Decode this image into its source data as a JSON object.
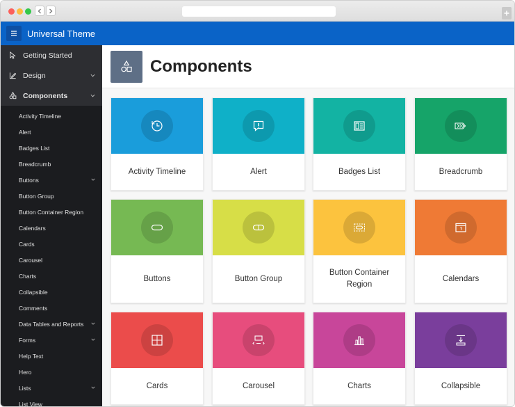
{
  "app": {
    "title": "Universal Theme"
  },
  "icons": {
    "menu": "hamburger-icon",
    "back": "chevron-left-icon",
    "forward": "chevron-right-icon",
    "newtab": "plus-icon"
  },
  "sidebar": {
    "top_items": [
      {
        "label": "Getting Started",
        "icon": "pointer-icon"
      },
      {
        "label": "Design",
        "icon": "design-icon"
      },
      {
        "label": "Components",
        "icon": "shapes-icon"
      }
    ],
    "sub_items": [
      {
        "label": "Activity Timeline"
      },
      {
        "label": "Alert"
      },
      {
        "label": "Badges List"
      },
      {
        "label": "Breadcrumb"
      },
      {
        "label": "Buttons"
      },
      {
        "label": "Button Group"
      },
      {
        "label": "Button Container Region"
      },
      {
        "label": "Calendars"
      },
      {
        "label": "Cards"
      },
      {
        "label": "Carousel"
      },
      {
        "label": "Charts"
      },
      {
        "label": "Collapsible"
      },
      {
        "label": "Comments"
      },
      {
        "label": "Data Tables and Reports"
      },
      {
        "label": "Forms"
      },
      {
        "label": "Help Text"
      },
      {
        "label": "Hero"
      },
      {
        "label": "Lists"
      },
      {
        "label": "List View"
      }
    ]
  },
  "page": {
    "title": "Components",
    "icon": "shapes-icon"
  },
  "cards": [
    {
      "label": "Activity Timeline",
      "color": "#1a9ddb",
      "icon": "clock-icon"
    },
    {
      "label": "Alert",
      "color": "#0fb0c8",
      "icon": "alert-icon"
    },
    {
      "label": "Badges List",
      "color": "#13b3a3",
      "icon": "badges-icon"
    },
    {
      "label": "Breadcrumb",
      "color": "#16a469",
      "icon": "breadcrumb-icon"
    },
    {
      "label": "Buttons",
      "color": "#76b953",
      "icon": "button-icon"
    },
    {
      "label": "Button Group",
      "color": "#d7de47",
      "icon": "button-group-icon"
    },
    {
      "label": "Button Container Region",
      "color": "#fcc33e",
      "icon": "button-container-icon"
    },
    {
      "label": "Calendars",
      "color": "#ef7a35",
      "icon": "calendar-icon"
    },
    {
      "label": "Cards",
      "color": "#eb4c4b",
      "icon": "cards-icon"
    },
    {
      "label": "Carousel",
      "color": "#e74d7d",
      "icon": "carousel-icon"
    },
    {
      "label": "Charts",
      "color": "#c8469a",
      "icon": "chart-icon"
    },
    {
      "label": "Collapsible",
      "color": "#7a3e9c",
      "icon": "collapsible-icon"
    }
  ]
}
